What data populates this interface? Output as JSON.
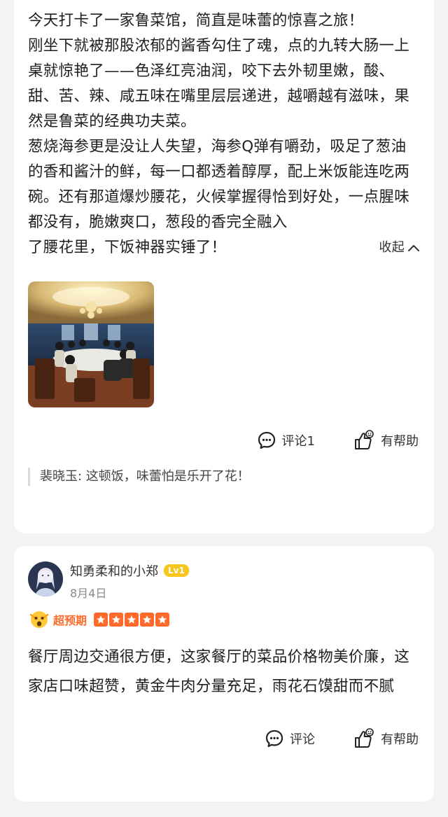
{
  "review1": {
    "paragraphs": [
      "今天打卡了一家鲁菜馆，简直是味蕾的惊喜之旅！",
      "刚坐下就被那股浓郁的酱香勾住了魂，点的九转大肠一上桌就惊艳了——色泽红亮油润，咬下去外韧里嫩，酸、甜、苦、辣、咸五味在嘴里层层递进，越嚼越有滋味，果然是鲁菜的经典功夫菜。",
      "葱烧海参更是没让人失望，海参Q弹有嚼劲，吸足了葱油的香和酱汁的鲜，每一口都透着醇厚，配上米饭能连吃两碗。还有那道爆炒腰花，火候掌握得恰到好处，一点腥味都没有，脆嫩爽口，葱段的香完全融入"
    ],
    "last_line": "了腰花里，下饭神器实锤了！",
    "collapse_label": "收起",
    "comment_label": "评论1",
    "helpful_label": "有帮助",
    "comment_preview": "裴晓玉: 这顿饭，味蕾怕是乐开了花！"
  },
  "review2": {
    "username": "知勇柔和的小郑",
    "level": "Lv1",
    "date": "8月4日",
    "rating_label": "超预期",
    "stars": 5,
    "text": "餐厅周边交通很方便，这家餐厅的菜品价格物美价廉，这家店口味超赞，黄金牛肉分量充足，雨花石馍甜而不腻",
    "comment_label": "评论",
    "helpful_label": "有帮助"
  },
  "colors": {
    "accent": "#ff6a2b",
    "level_badge": "#f7c61d"
  }
}
